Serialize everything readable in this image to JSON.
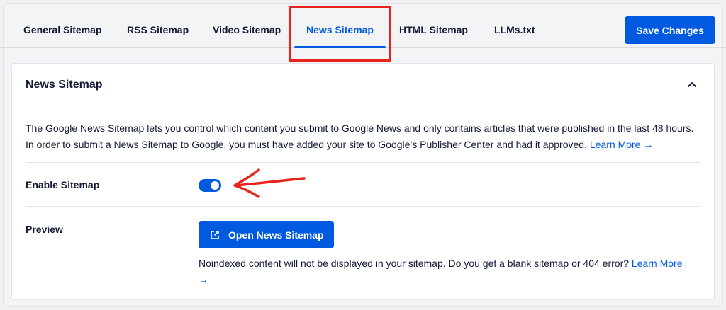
{
  "tabs": [
    {
      "label": "General Sitemap",
      "active": false
    },
    {
      "label": "RSS Sitemap",
      "active": false
    },
    {
      "label": "Video Sitemap",
      "active": false
    },
    {
      "label": "News Sitemap",
      "active": true
    },
    {
      "label": "HTML Sitemap",
      "active": false
    },
    {
      "label": "LLMs.txt",
      "active": false
    }
  ],
  "toolbar": {
    "save_label": "Save Changes"
  },
  "card": {
    "title": "News Sitemap",
    "description": "The Google News Sitemap lets you control which content you submit to Google News and only contains articles that were published in the last 48 hours. In order to submit a News Sitemap to Google, you must have added your site to Google’s Publisher Center and had it approved.",
    "description_link": "Learn More",
    "enable_label": "Enable Sitemap",
    "enable_on": true,
    "preview_label": "Preview",
    "open_button_label": "Open News Sitemap",
    "note": "Noindexed content will not be displayed in your sitemap. Do you get a blank sitemap or 404 error?",
    "note_link": "Learn More"
  },
  "icons": {
    "chevron": "chevron-up-icon",
    "external": "external-link-icon",
    "arrow": "arrow-right-icon"
  },
  "colors": {
    "accent": "#005ae0",
    "annotation": "#e8231b",
    "text": "#141b38"
  }
}
